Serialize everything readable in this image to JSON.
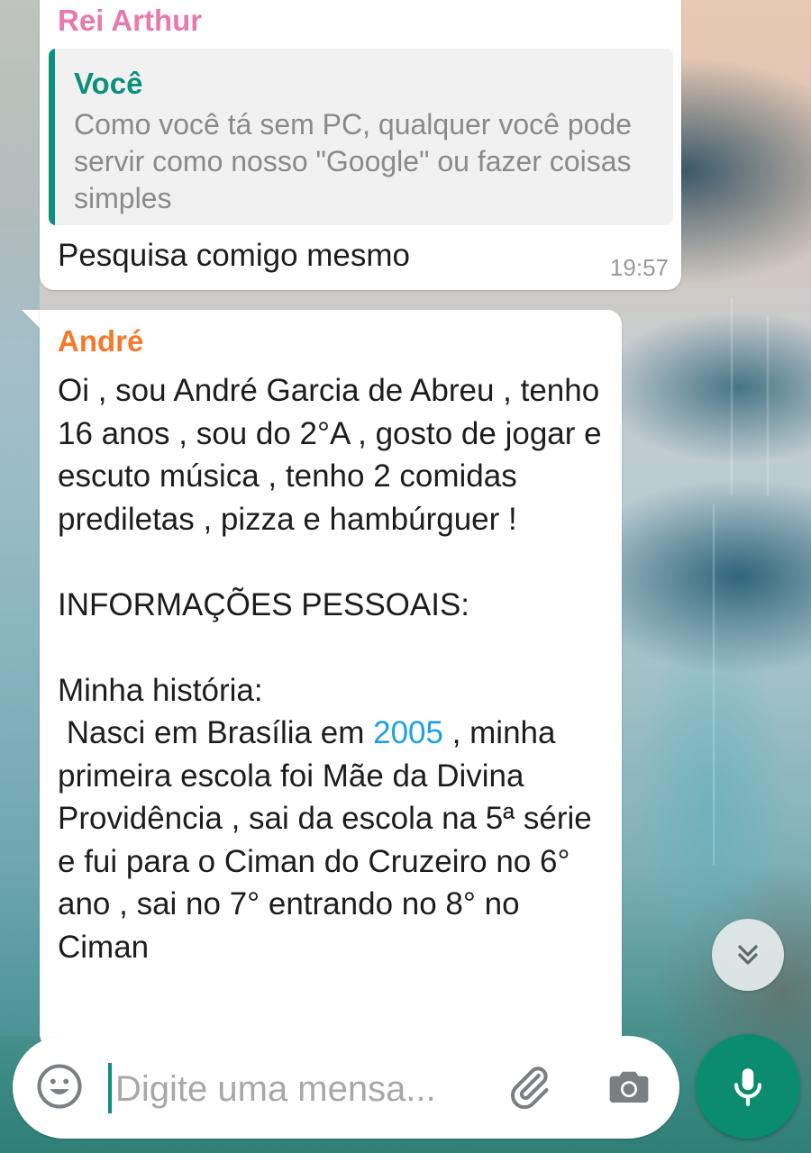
{
  "chat": {
    "messages": [
      {
        "sender": "Rei Arthur",
        "quoted": {
          "author": "Você",
          "text": "Como você tá sem PC, qualquer você pode servir como nosso \"Google\" ou fazer coisas simples"
        },
        "text": "Pesquisa comigo mesmo",
        "time": "19:57"
      },
      {
        "sender": "André",
        "lines": {
          "p1": "Oi , sou André Garcia de Abreu , tenho 16 anos , sou do 2°A , gosto de jogar e escuto música , tenho 2 comidas prediletas , pizza e hambúrguer !",
          "p2": "INFORMAÇÕES PESSOAIS:",
          "p3": "Minha história:",
          "p4_before": " Nasci em Brasília em ",
          "p4_link": "2005",
          "p4_after": " , minha primeira escola foi Mãe da Divina Providência , sai da escola na 5ª série e fui para o Ciman do Cruzeiro no 6° ano , sai no 7° entrando no 8° no Ciman"
        }
      }
    ]
  },
  "composer": {
    "placeholder": "Digite uma mensa...",
    "value": ""
  },
  "icons": {
    "emoji": "emoji-icon",
    "attach": "paperclip-icon",
    "camera": "camera-icon",
    "mic": "mic-icon",
    "scroll": "double-chevron-down-icon"
  },
  "colors": {
    "accent": "#0c8f7c",
    "mic_button": "#0c8c6f",
    "sender_rei_arthur": "#e87ab0",
    "sender_andre": "#f47a2c",
    "link": "#1ea0e8"
  }
}
